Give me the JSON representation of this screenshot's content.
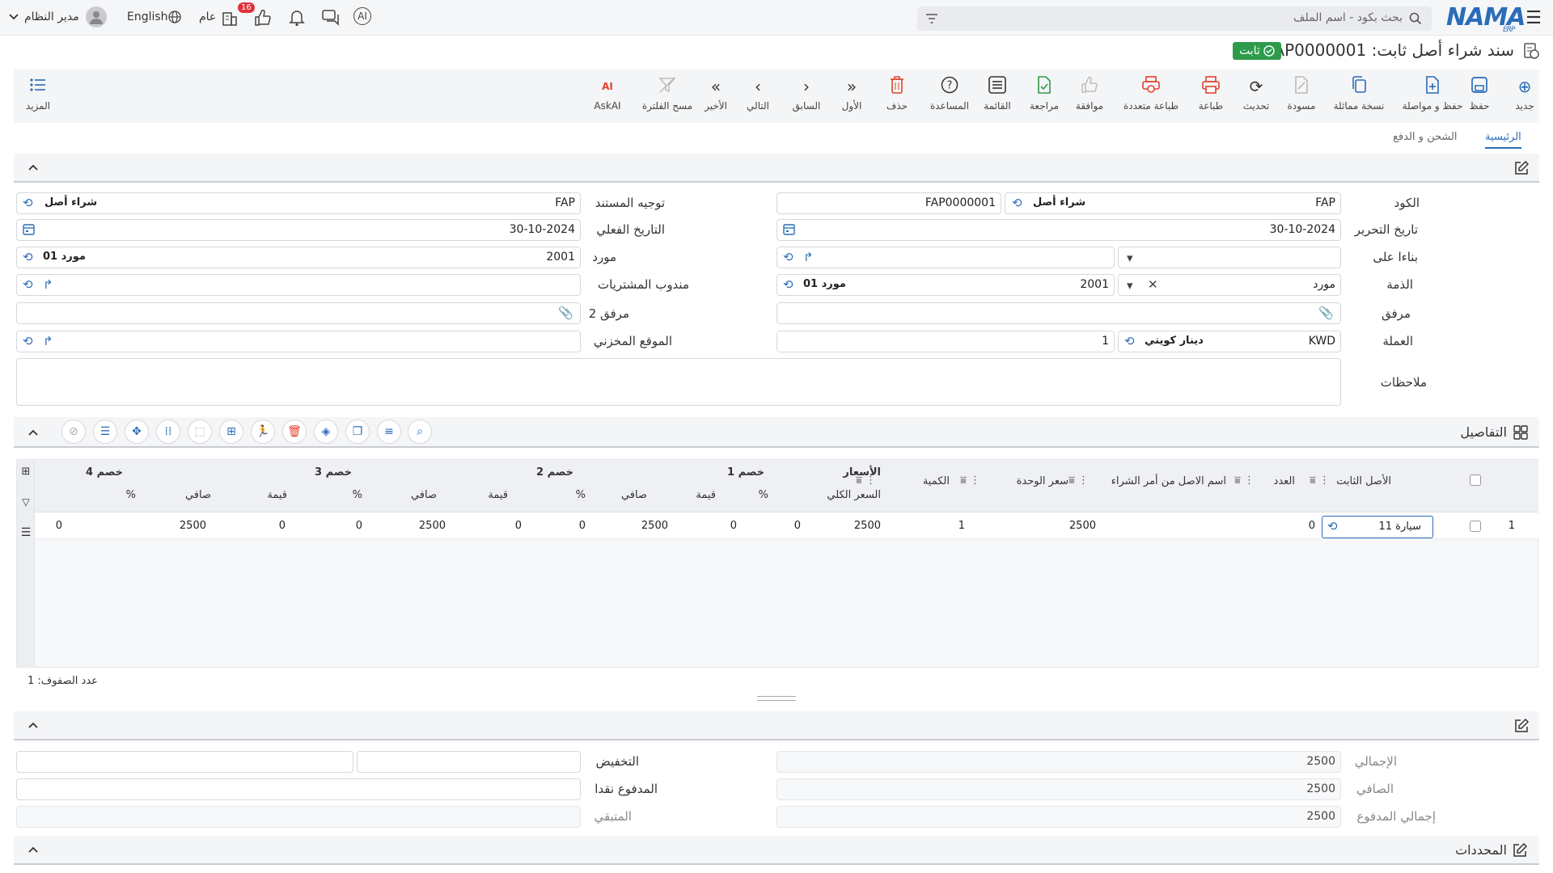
{
  "topbar": {
    "search_placeholder": "بحث بكود - اسم الملف",
    "logo_text": "NAMA",
    "logo_sub": "ERP",
    "user_name": "مدير النظام",
    "language": "English",
    "public_label": "عام",
    "notifications_count": "16"
  },
  "page": {
    "title": "سند شراء أصل ثابت: FAP0000001",
    "status": "ثابت"
  },
  "toolbar": {
    "new": "جديد",
    "save": "حفظ",
    "save_continue": "حفظ و مواصلة",
    "copy": "نسخة مماثلة",
    "draft": "مسودة",
    "refresh": "تحديث",
    "print": "طباعة",
    "multi_print": "طباعة متعددة",
    "approve": "موافقة",
    "review": "مراجعة",
    "list": "القائمة",
    "help": "المساعدة",
    "delete": "حذف",
    "first": "الأول",
    "previous": "السابق",
    "next": "التالي",
    "last": "الأخير",
    "clear_filter": "مسح الفلترة",
    "askai": "AskAI",
    "more": "المزيد"
  },
  "tabs": {
    "main": "الرئيسية",
    "shipping": "الشحن و الدفع"
  },
  "form": {
    "code_label": "الكود",
    "code_value": "FAP",
    "code_name": "شراء أصل",
    "code_number": "FAP0000001",
    "date_label": "تاريخ التحرير",
    "date_value": "30-10-2024",
    "based_on_label": "بناءا على",
    "liability_label": "الذمة",
    "liability_type": "مورد",
    "liability_code": "2001",
    "liability_name": "مورد 01",
    "attachment_label": "مرفق",
    "currency_label": "العملة",
    "currency_code": "KWD",
    "currency_name": "دينار كويتي",
    "currency_rate": "1",
    "notes_label": "ملاحظات",
    "doc_direction_label": "توجيه المستند",
    "doc_direction_value": "FAP",
    "doc_direction_name": "شراء أصل",
    "actual_date_label": "التاريخ الفعلي",
    "actual_date_value": "30-10-2024",
    "supplier_label": "مورد",
    "supplier_code": "2001",
    "supplier_name": "مورد 01",
    "purchase_rep_label": "مندوب المشتريات",
    "attachment2_label": "مرفق 2",
    "warehouse_label": "الموقع المخزني"
  },
  "details": {
    "title": "التفاصيل",
    "headers": {
      "asset": "الأصل الثابت",
      "count": "العدد",
      "po_asset_name": "اسم الاصل من أمر الشراء",
      "unit_price": "سعر الوحدة",
      "quantity": "الكمية",
      "prices_group": "الأسعار",
      "total_price": "السعر الكلي",
      "disc1": "خصم 1",
      "disc2": "خصم 2",
      "disc3": "خصم 3",
      "disc4": "خصم 4",
      "pct": "%",
      "value": "قيمة",
      "net": "صافي"
    },
    "rows": [
      {
        "num": "1",
        "asset": "سيارة 11",
        "count": "0",
        "po_asset_name": "",
        "unit_price": "2500",
        "quantity": "1",
        "total_price": "2500",
        "d1_pct": "0",
        "d1_val": "0",
        "d1_net": "2500",
        "d2_pct": "0",
        "d2_val": "0",
        "d2_net": "2500",
        "d3_pct": "0",
        "d3_val": "0",
        "d3_net": "2500",
        "d4_pct": "0"
      }
    ],
    "row_count_label": "عدد الصفوف: 1"
  },
  "totals": {
    "total_label": "الإجمالي",
    "total_value": "2500",
    "net_label": "الصافي",
    "net_value": "2500",
    "paid_total_label": "إجمالي المدفوع",
    "paid_total_value": "2500",
    "discount_label": "التخفيض",
    "cash_paid_label": "المدفوع نقدا",
    "remaining_label": "المتبقي"
  },
  "footer": {
    "selectors_label": "المحددات"
  },
  "colors": {
    "accent": "#2b6cb8",
    "success": "#2e9b4b",
    "danger": "#e0422e"
  }
}
